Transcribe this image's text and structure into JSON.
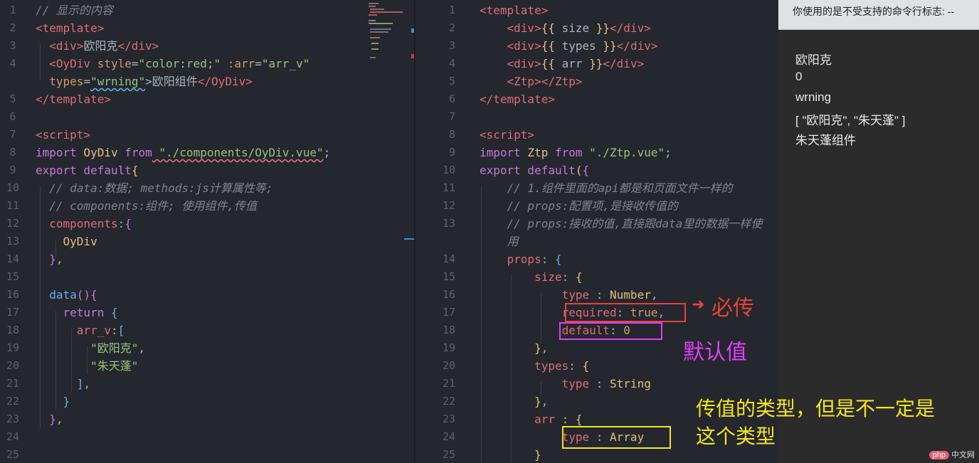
{
  "left_editor": {
    "lines": [
      {
        "n": "1",
        "tokens": [
          [
            "cm",
            "// 显示的内容"
          ]
        ]
      },
      {
        "n": "2",
        "tokens": [
          [
            "tag",
            "<template>"
          ]
        ]
      },
      {
        "n": "3",
        "tokens": [
          [
            "pun",
            "  "
          ],
          [
            "tag",
            "<div>"
          ],
          [
            "pun",
            "欧阳克"
          ],
          [
            "tag",
            "</div>"
          ]
        ]
      },
      {
        "n": "4",
        "tokens": [
          [
            "pun",
            "  "
          ],
          [
            "tag",
            "<OyDiv"
          ],
          [
            "attr",
            " style"
          ],
          [
            "pun",
            "="
          ],
          [
            "str",
            "\"color:red;\""
          ],
          [
            "attr",
            " :arr"
          ],
          [
            "pun",
            "="
          ],
          [
            "str",
            "\"arr_v\""
          ]
        ]
      },
      {
        "n": "",
        "tokens": [
          [
            "pun",
            "  "
          ],
          [
            "attr",
            "types"
          ],
          [
            "pun",
            "="
          ],
          [
            "str",
            "\"wrning\""
          ],
          [
            "pun",
            ">欧阳组件"
          ],
          [
            "tag",
            "</OyDiv>"
          ]
        ]
      },
      {
        "n": "5",
        "tokens": [
          [
            "tag",
            "</template>"
          ]
        ]
      },
      {
        "n": "6",
        "tokens": []
      },
      {
        "n": "7",
        "tokens": [
          [
            "tag",
            "<script>"
          ]
        ]
      },
      {
        "n": "8",
        "tokens": [
          [
            "kw",
            "import"
          ],
          [
            "cls",
            " OyDiv"
          ],
          [
            "kw",
            " from"
          ],
          [
            "str",
            " \"./components/OyDiv.vue\""
          ],
          [
            "pun",
            ";"
          ]
        ]
      },
      {
        "n": "9",
        "tokens": [
          [
            "kw",
            "export"
          ],
          [
            "kw",
            " default"
          ],
          [
            "brk1",
            "{"
          ]
        ]
      },
      {
        "n": "10",
        "tokens": [
          [
            "cm",
            "  // data:数据; methods:js计算属性等;"
          ]
        ]
      },
      {
        "n": "11",
        "tokens": [
          [
            "cm",
            "  // components:组件; 使用组件,传值"
          ]
        ]
      },
      {
        "n": "12",
        "tokens": [
          [
            "tag",
            "  components"
          ],
          [
            "pun",
            ":"
          ],
          [
            "brk2",
            "{"
          ]
        ]
      },
      {
        "n": "13",
        "tokens": [
          [
            "cls",
            "    OyDiv"
          ]
        ]
      },
      {
        "n": "14",
        "tokens": [
          [
            "brk2",
            "  }"
          ],
          [
            "pun",
            ","
          ]
        ]
      },
      {
        "n": "15",
        "tokens": []
      },
      {
        "n": "16",
        "tokens": [
          [
            "fn",
            "  data"
          ],
          [
            "brk2",
            "()"
          ],
          [
            "brk2",
            "{"
          ]
        ]
      },
      {
        "n": "17",
        "tokens": [
          [
            "kw",
            "    return"
          ],
          [
            "brk3",
            " {"
          ]
        ]
      },
      {
        "n": "18",
        "tokens": [
          [
            "tag",
            "      arr_v"
          ],
          [
            "pun",
            ":"
          ],
          [
            "brk3",
            "["
          ]
        ]
      },
      {
        "n": "19",
        "tokens": [
          [
            "str",
            "        \"欧阳克\""
          ],
          [
            "pun",
            ","
          ]
        ]
      },
      {
        "n": "20",
        "tokens": [
          [
            "str",
            "        \"朱天蓬\""
          ]
        ]
      },
      {
        "n": "21",
        "tokens": [
          [
            "brk3",
            "      ]"
          ],
          [
            "pun",
            ","
          ]
        ]
      },
      {
        "n": "22",
        "tokens": [
          [
            "brk3",
            "    }"
          ]
        ]
      },
      {
        "n": "23",
        "tokens": [
          [
            "brk2",
            "  }"
          ],
          [
            "pun",
            ","
          ]
        ]
      },
      {
        "n": "24",
        "tokens": []
      },
      {
        "n": "25",
        "tokens": []
      }
    ]
  },
  "right_editor": {
    "lines": [
      {
        "n": "1",
        "tokens": [
          [
            "tag",
            "<template>"
          ]
        ]
      },
      {
        "n": "2",
        "tokens": [
          [
            "pun",
            "    "
          ],
          [
            "tag",
            "<div>"
          ],
          [
            "brk1",
            "{{"
          ],
          [
            "pun",
            " size "
          ],
          [
            "brk1",
            "}}"
          ],
          [
            "tag",
            "</div>"
          ]
        ]
      },
      {
        "n": "3",
        "tokens": [
          [
            "pun",
            "    "
          ],
          [
            "tag",
            "<div>"
          ],
          [
            "brk1",
            "{{"
          ],
          [
            "pun",
            " types "
          ],
          [
            "brk1",
            "}}"
          ],
          [
            "tag",
            "</div>"
          ]
        ]
      },
      {
        "n": "4",
        "tokens": [
          [
            "pun",
            "    "
          ],
          [
            "tag",
            "<div>"
          ],
          [
            "brk1",
            "{{"
          ],
          [
            "pun",
            " arr "
          ],
          [
            "brk1",
            "}}"
          ],
          [
            "tag",
            "</div>"
          ]
        ]
      },
      {
        "n": "5",
        "tokens": [
          [
            "pun",
            "    "
          ],
          [
            "tag",
            "<Ztp></Ztp>"
          ]
        ]
      },
      {
        "n": "6",
        "tokens": [
          [
            "tag",
            "</template>"
          ]
        ]
      },
      {
        "n": "7",
        "tokens": []
      },
      {
        "n": "8",
        "tokens": [
          [
            "tag",
            "<script>"
          ]
        ]
      },
      {
        "n": "9",
        "tokens": [
          [
            "kw",
            "import"
          ],
          [
            "cls",
            " Ztp"
          ],
          [
            "kw",
            " from"
          ],
          [
            "str",
            " \"./Ztp.vue\""
          ],
          [
            "pun",
            ";"
          ]
        ]
      },
      {
        "n": "10",
        "tokens": [
          [
            "kw",
            "export"
          ],
          [
            "kw",
            " default"
          ],
          [
            "brk1",
            "("
          ],
          [
            "brk2",
            "{"
          ]
        ]
      },
      {
        "n": "11",
        "tokens": [
          [
            "cm",
            "    // 1.组件里面的api都是和页面文件一样的"
          ]
        ]
      },
      {
        "n": "12",
        "tokens": [
          [
            "cm",
            "    // props:配置项,是接收传值的"
          ]
        ]
      },
      {
        "n": "13",
        "tokens": [
          [
            "cm",
            "    // props:接收的值,直接跟data里的数据一样使"
          ]
        ]
      },
      {
        "n": "",
        "tokens": [
          [
            "cm",
            "    用"
          ]
        ]
      },
      {
        "n": "14",
        "tokens": [
          [
            "tag",
            "    props"
          ],
          [
            "pun",
            ": "
          ],
          [
            "brk3",
            "{"
          ]
        ]
      },
      {
        "n": "15",
        "tokens": [
          [
            "tag",
            "        size"
          ],
          [
            "pun",
            ": "
          ],
          [
            "brk1",
            "{"
          ]
        ]
      },
      {
        "n": "16",
        "tokens": [
          [
            "tag",
            "            type"
          ],
          [
            "pun",
            " : "
          ],
          [
            "cls",
            "Number"
          ],
          [
            "pun",
            ","
          ]
        ]
      },
      {
        "n": "17",
        "tokens": [
          [
            "tag",
            "            required"
          ],
          [
            "pun",
            ": "
          ],
          [
            "num",
            "true"
          ],
          [
            "pun",
            ","
          ]
        ]
      },
      {
        "n": "18",
        "tokens": [
          [
            "tag",
            "            default"
          ],
          [
            "pun",
            ": "
          ],
          [
            "num",
            "0"
          ]
        ]
      },
      {
        "n": "19",
        "tokens": [
          [
            "brk1",
            "        }"
          ],
          [
            "pun",
            ","
          ]
        ]
      },
      {
        "n": "20",
        "tokens": [
          [
            "tag",
            "        types"
          ],
          [
            "pun",
            ": "
          ],
          [
            "brk1",
            "{"
          ]
        ]
      },
      {
        "n": "21",
        "tokens": [
          [
            "tag",
            "            type"
          ],
          [
            "pun",
            " : "
          ],
          [
            "cls",
            "String"
          ]
        ]
      },
      {
        "n": "22",
        "tokens": [
          [
            "brk1",
            "        }"
          ],
          [
            "pun",
            ","
          ]
        ]
      },
      {
        "n": "23",
        "tokens": [
          [
            "tag",
            "        arr"
          ],
          [
            "pun",
            " : "
          ],
          [
            "brk1",
            "{"
          ]
        ]
      },
      {
        "n": "24",
        "tokens": [
          [
            "tag",
            "            type"
          ],
          [
            "pun",
            " : "
          ],
          [
            "cls",
            "Array"
          ]
        ]
      },
      {
        "n": "25",
        "tokens": [
          [
            "brk1",
            "        }"
          ]
        ]
      }
    ]
  },
  "preview": {
    "infobar_text": "你使用的是不受支持的命令行标志: --",
    "lines": [
      "欧阳克",
      "0",
      "wrning",
      "[ \"欧阳克\", \"朱天蓬\" ]",
      "朱天蓬组件"
    ]
  },
  "annotations": {
    "required_note": "必传",
    "default_note": "默认值",
    "type_note_line1": "传值的类型，但是不一定是",
    "type_note_line2": "这个类型",
    "arrow": "➜",
    "colors": {
      "red": "#e8413c",
      "magenta": "#e040fb",
      "yellow": "#f5e61c"
    }
  },
  "watermark": {
    "logo": "php",
    "text": "中文网"
  }
}
